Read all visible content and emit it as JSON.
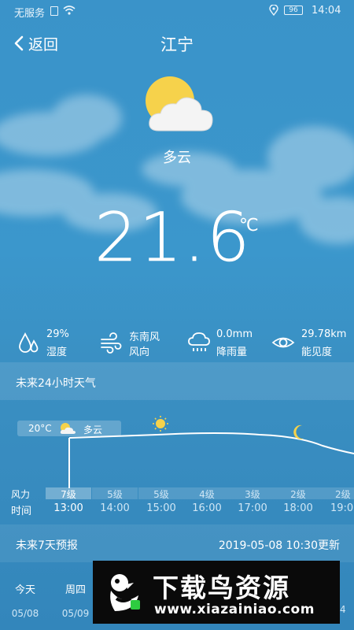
{
  "status_bar": {
    "carrier": "无服务",
    "battery": "96",
    "time": "14:04"
  },
  "header": {
    "back_label": "返回",
    "city": "江宁"
  },
  "current": {
    "condition": "多云",
    "temperature": "21.6",
    "unit": "℃",
    "weather_icon": "sun-behind-cloud-icon"
  },
  "stats": [
    {
      "icon": "humidity-drops-icon",
      "value": "29%",
      "label": "湿度"
    },
    {
      "icon": "wind-icon",
      "value": "东南风",
      "label": "风向"
    },
    {
      "icon": "rain-cloud-icon",
      "value": "0.0mm",
      "label": "降雨量"
    },
    {
      "icon": "eye-icon",
      "value": "29.78km",
      "label": "能见度"
    }
  ],
  "hourly": {
    "title": "未来24小时天气",
    "now_badge": {
      "temp": "20°C",
      "condition": "多云"
    },
    "wind_label": "风力",
    "time_label": "时间",
    "wind": [
      "7级",
      "5级",
      "5级",
      "4级",
      "3级",
      "2级",
      "2级"
    ],
    "times": [
      "13:00",
      "14:00",
      "15:00",
      "16:00",
      "17:00",
      "18:00",
      "19:00"
    ],
    "icons": [
      "sun-behind-cloud-icon",
      "sun-icon",
      "moon-icon"
    ]
  },
  "forecast": {
    "title": "未来7天预报",
    "updated": "2019-05-08 10:30更新",
    "days": [
      {
        "name": "今天",
        "date": "05/08"
      },
      {
        "name": "周四",
        "date": "05/09"
      }
    ],
    "last_visible_fragment": "4"
  },
  "watermark": {
    "title": "下载鸟资源",
    "url": "www.xiazainiao.com"
  },
  "colors": {
    "background": "#3a93c9",
    "panel": "#ffffff1a",
    "watermark_bg": "#0a0a0a",
    "sun": "#f6d24b"
  }
}
